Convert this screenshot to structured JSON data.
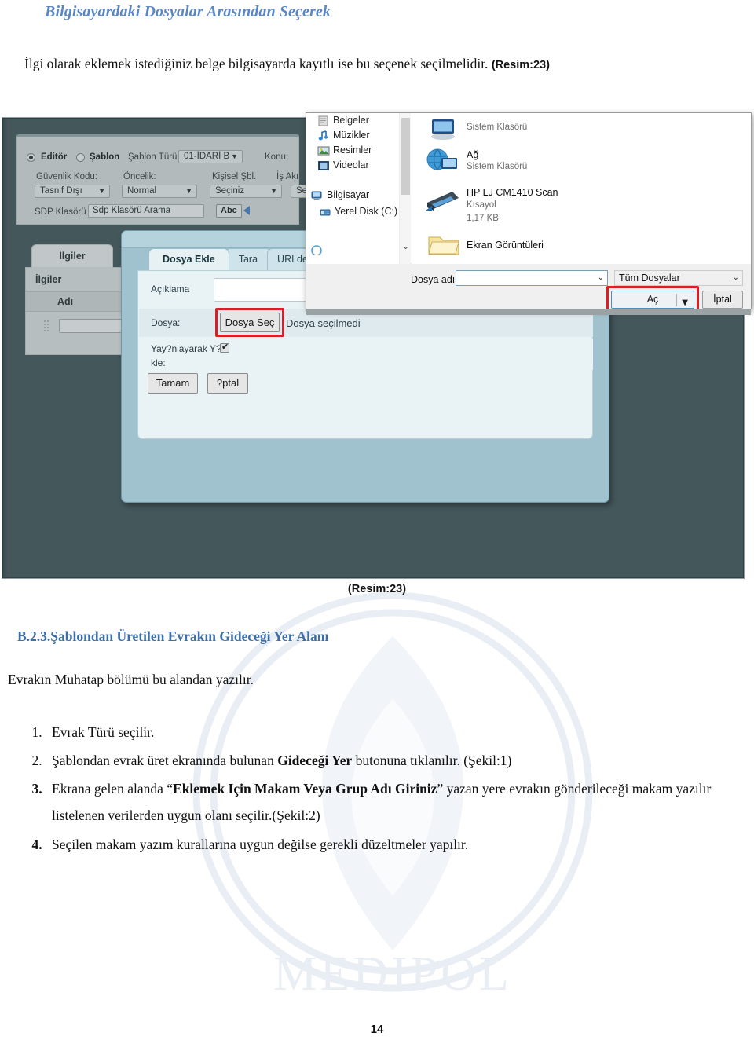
{
  "document": {
    "title": "Bilgisayardaki Dosyalar Arasından Seçerek",
    "intro_text": "İlgi olarak eklemek istediğiniz belge bilgisayarda kayıtlı ise bu seçenek seçilmelidir.",
    "intro_ref": "(Resim:23)",
    "figure_caption": "(Resim:23)",
    "section_heading": "B.2.3.Şablondan Üretilen Evrakın Gideceği Yer Alanı",
    "paragraph": "Evrakın Muhatap bölümü bu alandan yazılır.",
    "page_number": "14",
    "watermark_text": "MEDIPOL ÜNİVERSİTESİ",
    "accent_color": "#5b86c4",
    "heading_color": "#3d6ea8",
    "highlight_color": "#d81f26"
  },
  "steps": [
    {
      "n": "1.",
      "parts": [
        {
          "t": "Evrak Türü seçilir.",
          "b": false
        }
      ]
    },
    {
      "n": "2.",
      "parts": [
        {
          "t": "Şablondan evrak üret ekranında bulunan  ",
          "b": false
        },
        {
          "t": "Gideceği Yer",
          "b": true
        },
        {
          "t": " butonuna tıklanılır. (Şekil:1)",
          "b": false
        }
      ]
    },
    {
      "n": "3.",
      "parts": [
        {
          "t": "Ekrana gelen alanda “",
          "b": false
        },
        {
          "t": "Eklemek Için Makam Veya Grup Adı Giriniz",
          "b": true
        },
        {
          "t": "” yazan yere evrakın gönderileceği makam yazılır listelenen verilerden uygun olanı seçilir.(Şekil:2)",
          "b": false
        }
      ]
    },
    {
      "n": "4.",
      "parts": [
        {
          "t": "Seçilen makam yazım kurallarına uygun değilse gerekli düzeltmeler yapılır.",
          "b": false
        }
      ]
    }
  ],
  "screenshot": {
    "app_form": {
      "radio_editor": "Editör",
      "radio_sablon": "Şablon",
      "label_sablon_turu": "Şablon Türü",
      "value_sablon_turu": "01-İDARİ B",
      "label_konu": "Konu:",
      "label_guvenlik_kodu": "Güvenlik Kodu:",
      "value_guvenlik_kodu": "Tasnif Dışı",
      "label_oncelik": "Öncelik:",
      "value_oncelik": "Normal",
      "label_kisisel_sbl": "Kişisel Şbl.",
      "value_kisisel_sbl": "Seçiniz",
      "label_is_akisi": "İş Akı",
      "value_is_akisi": "Seçin",
      "label_sdp_klasoru": "SDP Klasörü",
      "value_sdp_klasoru": "Sdp Klasörü Arama",
      "button_abc": "Abc"
    },
    "ilgiler_panel": {
      "tab_label": "İlgiler",
      "header": "İlgiler",
      "column_adi": "Adı"
    },
    "attach_dialog": {
      "tabs": [
        {
          "label": "Dosya Ekle",
          "active": true
        },
        {
          "label": "Tara",
          "active": false
        },
        {
          "label": "URLden E",
          "active": false
        }
      ],
      "label_aciklama": "Açıklama",
      "label_dosya": "Dosya:",
      "button_dosya_sec": "Dosya Seç",
      "status_no_file": "Dosya seçilmedi",
      "label_yayinlayarak": "Yay?nlayarak Y?",
      "label_yayinlayarak_2": "kle:",
      "checkbox_checked": true,
      "button_ok": "Tamam",
      "button_cancel": "?ptal"
    },
    "file_dialog": {
      "nav_items": [
        {
          "label": "Belgeler",
          "icon": "documents-icon"
        },
        {
          "label": "Müzikler",
          "icon": "music-icon"
        },
        {
          "label": "Resimler",
          "icon": "pictures-icon"
        },
        {
          "label": "Videolar",
          "icon": "videos-icon"
        },
        {
          "label": "Bilgisayar",
          "icon": "computer-icon"
        },
        {
          "label": "Yerel Disk (C:)",
          "icon": "drive-icon"
        }
      ],
      "files": [
        {
          "name": "",
          "sub1": "Sistem Klasörü",
          "sub2": "",
          "icon": "computer-icon"
        },
        {
          "name": "Ağ",
          "sub1": "Sistem Klasörü",
          "sub2": "",
          "icon": "network-icon"
        },
        {
          "name": "HP LJ CM1410 Scan",
          "sub1": "Kısayol",
          "sub2": "1,17 KB",
          "icon": "scanner-icon"
        },
        {
          "name": "Ekran Görüntüleri",
          "sub1": "",
          "sub2": "",
          "icon": "folder-icon"
        }
      ],
      "label_dosya_adi": "Dosya adı:",
      "value_dosya_adi": "",
      "filter_value": "Tüm Dosyalar",
      "button_open": "Aç",
      "button_cancel": "İptal"
    }
  }
}
